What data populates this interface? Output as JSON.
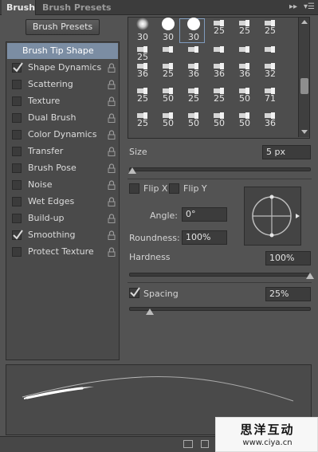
{
  "tabs": {
    "brush": "Brush",
    "presets": "Brush Presets"
  },
  "brush_presets_button": "Brush Presets",
  "brush_tip_shape": "Brush Tip Shape",
  "options": [
    {
      "label": "Shape Dynamics",
      "checked": true
    },
    {
      "label": "Scattering",
      "checked": false
    },
    {
      "label": "Texture",
      "checked": false
    },
    {
      "label": "Dual Brush",
      "checked": false
    },
    {
      "label": "Color Dynamics",
      "checked": false
    },
    {
      "label": "Transfer",
      "checked": false
    },
    {
      "label": "Brush Pose",
      "checked": false
    },
    {
      "label": "Noise",
      "checked": false
    },
    {
      "label": "Wet Edges",
      "checked": false
    },
    {
      "label": "Build-up",
      "checked": false
    },
    {
      "label": "Smoothing",
      "checked": true
    },
    {
      "label": "Protect Texture",
      "checked": false
    }
  ],
  "brush_grid": {
    "rows": [
      [
        "30",
        "30",
        "30",
        "25",
        "25",
        "25"
      ],
      [
        "25",
        "",
        "",
        "",
        "",
        ""
      ],
      [
        "36",
        "25",
        "36",
        "36",
        "36",
        "32"
      ],
      [
        "25",
        "50",
        "25",
        "25",
        "50",
        "71"
      ],
      [
        "25",
        "50",
        "50",
        "50",
        "50",
        "36"
      ]
    ],
    "selected_index": 2
  },
  "size": {
    "label": "Size",
    "value": "5 px",
    "fraction": 0.0
  },
  "flip_x": {
    "label": "Flip X",
    "checked": false
  },
  "flip_y": {
    "label": "Flip Y",
    "checked": false
  },
  "angle": {
    "label": "Angle:",
    "value": "0°"
  },
  "roundness": {
    "label": "Roundness:",
    "value": "100%"
  },
  "hardness": {
    "label": "Hardness",
    "value": "100%",
    "fraction": 1.0
  },
  "spacing": {
    "label": "Spacing",
    "value": "25%",
    "checked": true,
    "fraction": 0.1
  },
  "watermark": {
    "title": "思洋互动",
    "url": "www.ciya.cn"
  },
  "colors": {
    "selection": "#7b8da3",
    "panel": "#535353",
    "check": "#d8d8d8"
  }
}
